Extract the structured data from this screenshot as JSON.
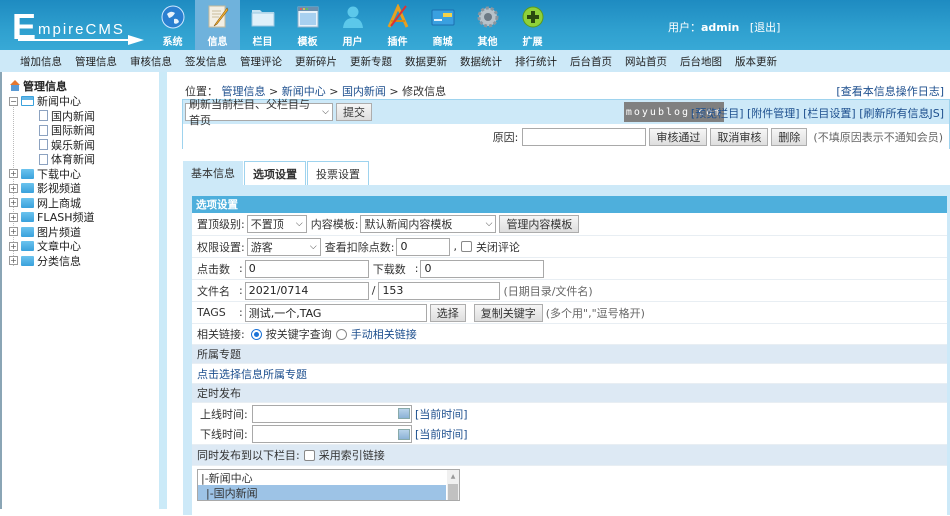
{
  "header": {
    "logo": {
      "big": "E",
      "rest": "mpireCMS"
    },
    "nav": [
      {
        "label": "系统",
        "icon": "globe-icon",
        "active": false
      },
      {
        "label": "信息",
        "icon": "edit-document-icon",
        "active": true
      },
      {
        "label": "栏目",
        "icon": "folder-icon",
        "active": false
      },
      {
        "label": "模板",
        "icon": "window-template-icon",
        "active": false
      },
      {
        "label": "用户",
        "icon": "user-icon",
        "active": false
      },
      {
        "label": "插件",
        "icon": "tools-icon",
        "active": false
      },
      {
        "label": "商城",
        "icon": "credit-card-icon",
        "active": false
      },
      {
        "label": "其他",
        "icon": "gear-icon",
        "active": false
      },
      {
        "label": "扩展",
        "icon": "plus-circle-icon",
        "active": false
      }
    ],
    "user_label": "用户：",
    "username": "admin",
    "logout": "[退出]"
  },
  "subnav": [
    "增加信息",
    "管理信息",
    "审核信息",
    "签发信息",
    "管理评论",
    "更新碎片",
    "更新专题",
    "数据更新",
    "数据统计",
    "排行统计",
    "后台首页",
    "网站首页",
    "后台地图",
    "版本更新"
  ],
  "sidebar": {
    "root": "管理信息",
    "expanded": {
      "label": "新闻中心",
      "children": [
        "国内新闻",
        "国际新闻",
        "娱乐新闻",
        "体育新闻"
      ]
    },
    "collapsed": [
      "下载中心",
      "影视频道",
      "网上商城",
      "FLASH频道",
      "图片频道",
      "文章中心",
      "分类信息"
    ]
  },
  "breadcrumb": {
    "prefix": "位置：",
    "items": [
      "管理信息",
      "新闻中心",
      "国内新闻"
    ],
    "sep": " > ",
    "current": "修改信息"
  },
  "oplog_link": "[查看本信息操作日志]",
  "actions": {
    "refresh_select": "刷新当前栏目、父栏目与首页",
    "submit": "提交",
    "watermark": "moyublog.com",
    "links": [
      "[预览栏目]",
      "[附件管理]",
      "[栏目设置]",
      "[刷新所有信息JS]"
    ],
    "reason_label": "原因:",
    "reason_value": "",
    "approve": "审核通过",
    "cancel_approve": "取消审核",
    "delete": "删除",
    "reason_hint": "(不填原因表示不通知会员)"
  },
  "tabs": [
    {
      "label": "基本信息",
      "active": false
    },
    {
      "label": "选项设置",
      "active": true
    },
    {
      "label": "投票设置",
      "active": false
    }
  ],
  "options": {
    "title": "选项设置",
    "top_level_label": "置顶级别:",
    "top_level_value": "不置顶",
    "template_label": "内容模板:",
    "template_value": "默认新闻内容模板",
    "manage_template": "管理内容模板",
    "permission_label": "权限设置:",
    "permission_value": "游客",
    "points_label": "查看扣除点数:",
    "points_value": "0",
    "close_comment": "关闭评论",
    "close_comment_checked": false,
    "clicks_label": "点击数",
    "clicks_value": "0",
    "downloads_label": "下载数",
    "downloads_value": "0",
    "filename_label": "文件名",
    "filename_dir": "2021/0714",
    "filename_name": "153",
    "filename_hint": "(日期目录/文件名)",
    "tags_label": "TAGS",
    "tags_value": "测试,一个,TAG",
    "select_btn": "选择",
    "copy_keywords": "复制关键字",
    "tags_hint": "(多个用\",\"逗号格开)",
    "related_label": "相关链接:",
    "related_opt1": "按关键字查询",
    "related_opt2": "手动相关链接",
    "related_selected": "按关键字查询",
    "special_header": "所属专题",
    "special_link": "点击选择信息所属专题",
    "schedule_header": "定时发布",
    "online_label": "上线时间:",
    "online_value": "",
    "offline_label": "下线时间:",
    "offline_value": "",
    "now_link": "[当前时间]",
    "publish_also_label": "同时发布到以下栏目:",
    "index_link_label": "采用索引链接",
    "index_link_checked": false,
    "columns": [
      "|-新闻中心",
      "|-国内新闻"
    ],
    "columns_selected": "|-国内新闻"
  }
}
